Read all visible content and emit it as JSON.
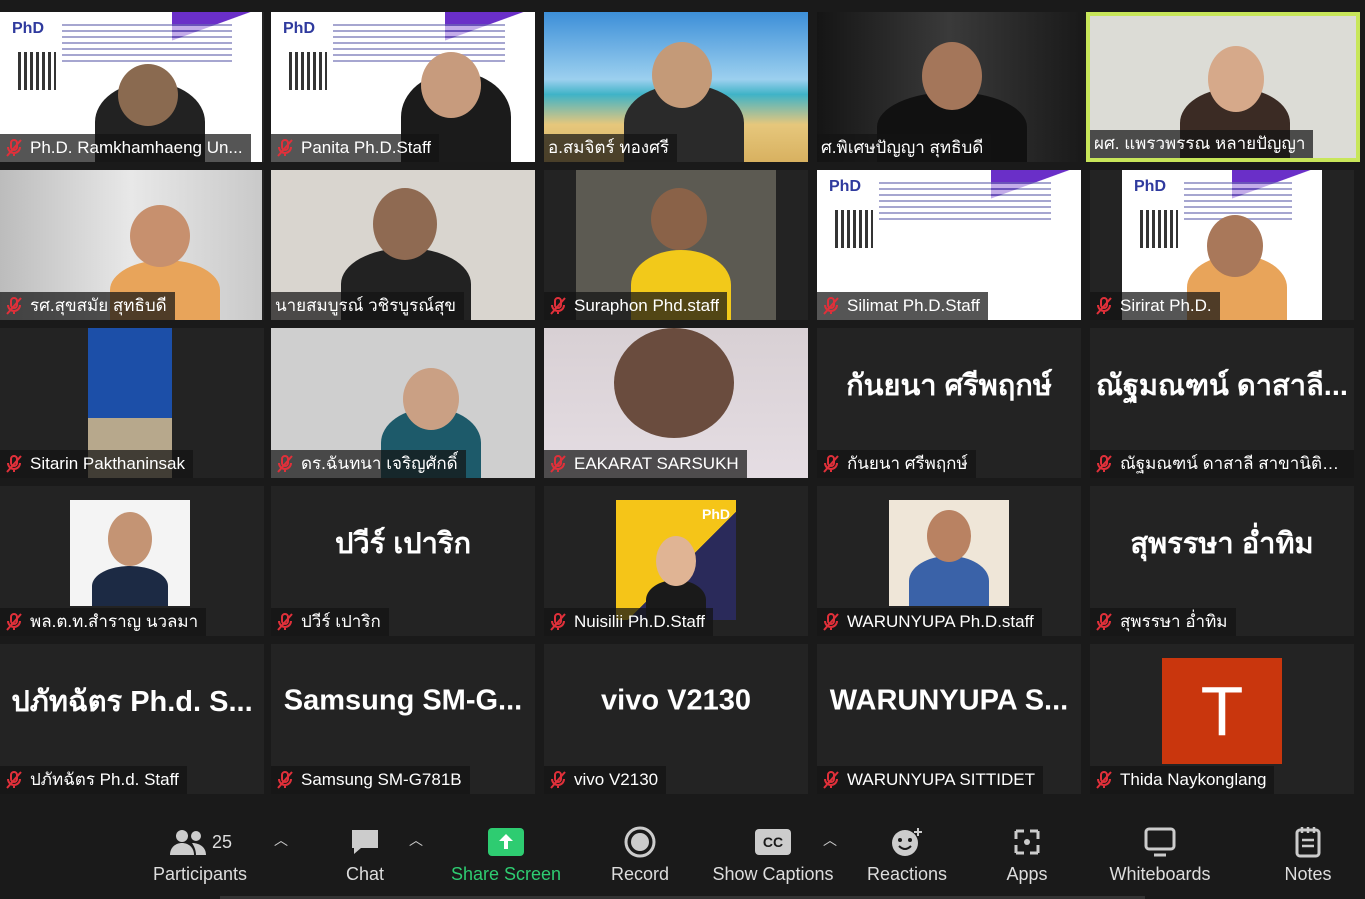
{
  "tiles": [
    {
      "name": "Ph.D. Ramkhamhaeng Un..."
    },
    {
      "name": "Panita Ph.D.Staff"
    },
    {
      "name": "อ.สมจิตร์ ทองศรี"
    },
    {
      "name": "ศ.พิเศษปัญญา สุทธิบดี"
    },
    {
      "name": "ผศ. แพรวพรรณ หลายปัญญา"
    },
    {
      "name": "รศ.สุขสมัย สุทธิบดี"
    },
    {
      "name": "นายสมบูรณ์ วชิรบูรณ์สุข"
    },
    {
      "name": "Suraphon Phd.staff"
    },
    {
      "name": "Silimat Ph.D.Staff"
    },
    {
      "name": "Sirirat Ph.D."
    },
    {
      "name": "Sitarin Pakthaninsak"
    },
    {
      "name": "ดร.ฉันทนา เจริญศักดิ์"
    },
    {
      "name": "EAKARAT SARSUKH"
    },
    {
      "name": "กันยนา ศรีพฤกษ์",
      "big": "กันยนา ศรีพฤกษ์"
    },
    {
      "name": "ณัฐมณฑน์ ดาสาลี สาขานิติศ...",
      "big": "ณัฐมณฑน์ ดาสาลี..."
    },
    {
      "name": "พล.ต.ท.สำราญ นวลมา"
    },
    {
      "name": "ปวีร์ เปาริก",
      "big": "ปวีร์ เปาริก"
    },
    {
      "name": "Nuisilii Ph.D.Staff"
    },
    {
      "name": "WARUNYUPA Ph.D.staff"
    },
    {
      "name": "สุพรรษา อ่ำทิม",
      "big": "สุพรรษา อ่ำทิม"
    },
    {
      "name": "ปภัทฉัตร Ph.d. Staff",
      "big": "ปภัทฉัตร Ph.d. S..."
    },
    {
      "name": "Samsung SM-G781B",
      "big": "Samsung SM-G..."
    },
    {
      "name": "vivo V2130",
      "big": "vivo V2130"
    },
    {
      "name": "WARUNYUPA SITTIDET",
      "big": "WARUNYUPA S..."
    },
    {
      "name": "Thida Naykonglang",
      "avatar_letter": "T"
    }
  ],
  "toolbar": {
    "participants_label": "Participants",
    "participants_count": "25",
    "chat_label": "Chat",
    "share_label": "Share Screen",
    "record_label": "Record",
    "captions_label": "Show Captions",
    "captions_icon_text": "CC",
    "reactions_label": "Reactions",
    "apps_label": "Apps",
    "whiteboards_label": "Whiteboards",
    "notes_label": "Notes"
  },
  "colors": {
    "active_speaker": "#c8e65a",
    "share_green": "#2ecc71",
    "muted_red": "#e0303a",
    "avatar_bg": "#c9360d"
  },
  "poster": {
    "logo": "PhD"
  }
}
